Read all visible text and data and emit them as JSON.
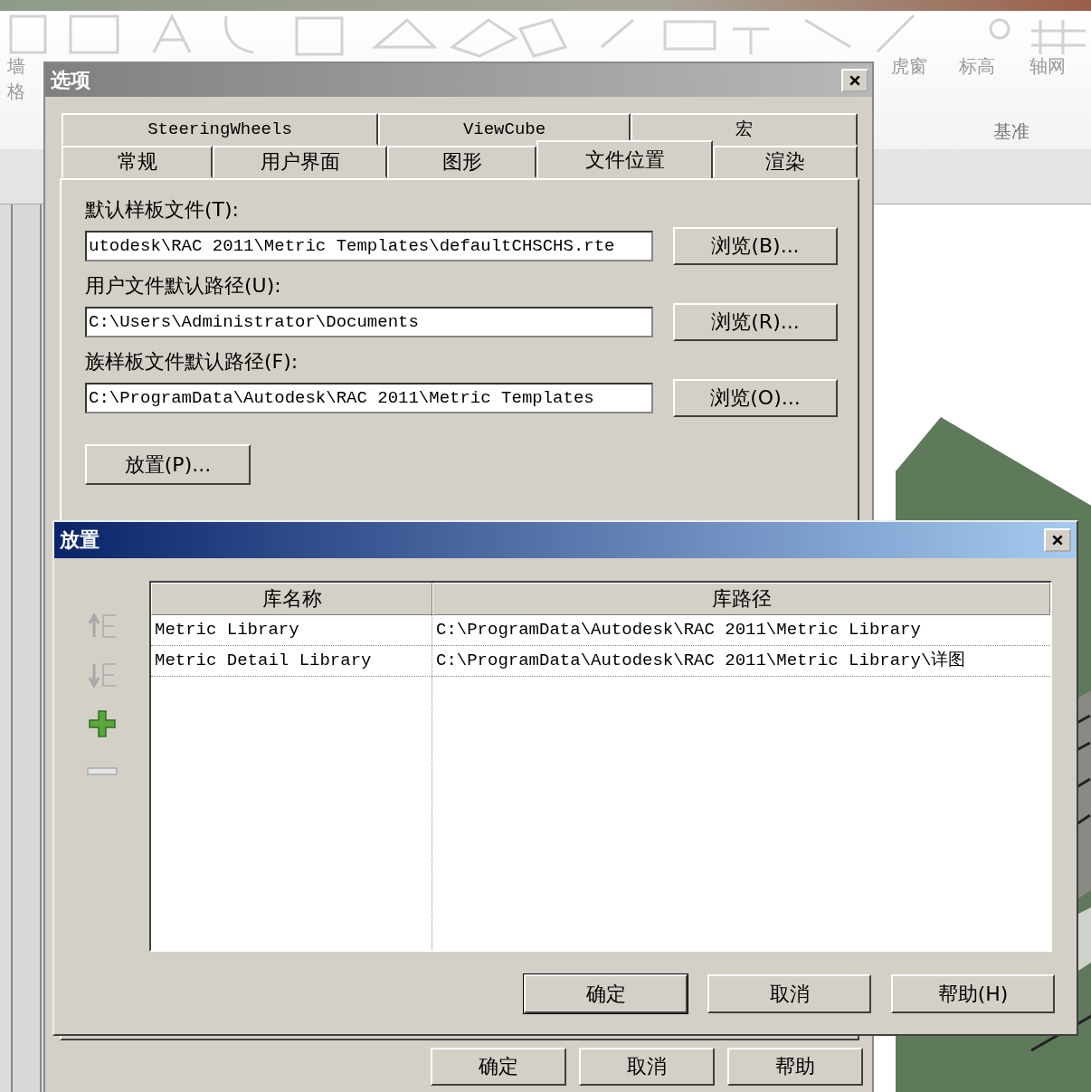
{
  "ribbon": {
    "left_labels": [
      "墙",
      "格"
    ],
    "labels": [
      "虎窗",
      "标高",
      "轴网"
    ],
    "panel_title": "基准"
  },
  "options_dialog": {
    "title": "选项",
    "tab_rows": [
      [
        {
          "label": "SteeringWheels",
          "selected": false
        },
        {
          "label": "ViewCube",
          "selected": false
        },
        {
          "label": "宏",
          "selected": false
        }
      ],
      [
        {
          "label": "常规",
          "selected": false
        },
        {
          "label": "用户界面",
          "selected": false
        },
        {
          "label": "图形",
          "selected": false
        },
        {
          "label": "文件位置",
          "selected": true
        },
        {
          "label": "渲染",
          "selected": false
        }
      ]
    ],
    "fields": [
      {
        "label": "默认样板文件(T):",
        "value": "utodesk\\RAC 2011\\Metric Templates\\defaultCHSCHS.rte",
        "button": "浏览(B)..."
      },
      {
        "label": "用户文件默认路径(U):",
        "value": "C:\\Users\\Administrator\\Documents",
        "button": "浏览(R)..."
      },
      {
        "label": "族样板文件默认路径(F):",
        "value": "C:\\ProgramData\\Autodesk\\RAC 2011\\Metric Templates",
        "button": "浏览(O)..."
      }
    ],
    "places_button": "放置(P)...",
    "buttons": [
      "确定",
      "取消",
      "帮助"
    ]
  },
  "places_dialog": {
    "title": "放置",
    "table": {
      "columns": [
        "库名称",
        "库路径"
      ],
      "rows": [
        [
          "Metric Library",
          "C:\\ProgramData\\Autodesk\\RAC 2011\\Metric Library"
        ],
        [
          "Metric Detail Library",
          "C:\\ProgramData\\Autodesk\\RAC 2011\\Metric Library\\详图"
        ]
      ]
    },
    "buttons": [
      "确定",
      "取消",
      "帮助(H)"
    ]
  }
}
